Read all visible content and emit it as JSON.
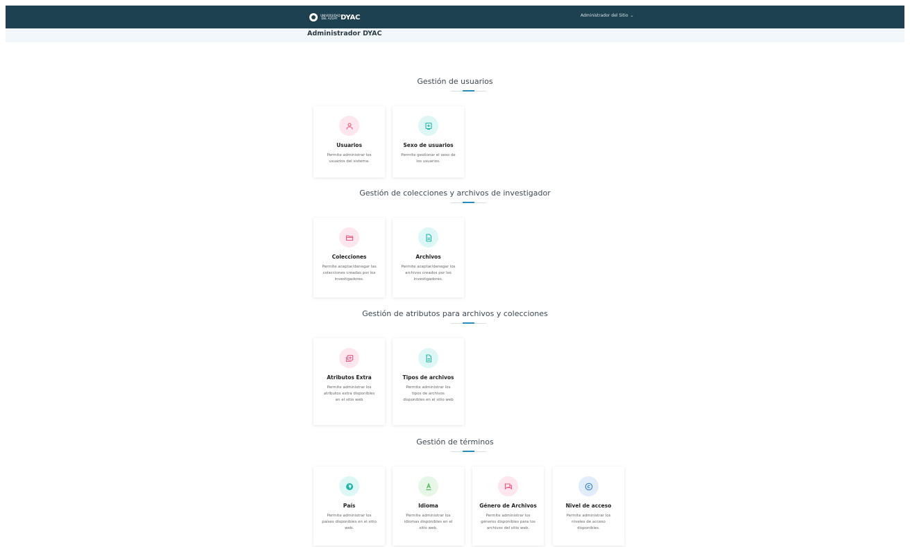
{
  "header": {
    "logo_univ": "UNIVERSIDAD DEL AZUAY",
    "logo_brand": "DYAC",
    "user_menu": "Administrador del Sitio",
    "subtitle": "Administrador DYAC"
  },
  "colors": {
    "topbar": "#1d4151",
    "accent": "#2a8bbd",
    "pink": "#e8577f",
    "teal": "#1fb5a8",
    "blue": "#2f7ed8",
    "green": "#43b24b"
  },
  "sections": [
    {
      "title": "Gestión de usuarios",
      "cards": [
        {
          "icon": "user-icon",
          "title": "Usuarios",
          "desc": "Permite administrar los usuarios del sistema."
        },
        {
          "icon": "id-badge-icon",
          "title": "Sexo de usuarios",
          "desc": "Permite gestionar el sexo de los usuarios."
        }
      ]
    },
    {
      "title": "Gestión de colecciones y archivos de investigador",
      "cards": [
        {
          "icon": "folder-icon",
          "title": "Colecciones",
          "desc": "Permite aceptar/denegar las colecciones creadas por los investigadores."
        },
        {
          "icon": "file-icon",
          "title": "Archivos",
          "desc": "Permite aceptar/denegar los archivos creados por los investigadores."
        }
      ]
    },
    {
      "title": "Gestión de atributos para archivos y colecciones",
      "cards": [
        {
          "icon": "add-box-icon",
          "title": "Atributos Extra",
          "desc": "Permite administrar los atributos extra disponibles en el sitio web"
        },
        {
          "icon": "document-icon",
          "title": "Tipos de archivos",
          "desc": "Permite administrar los tipos de archivos disponibles en el sitio web"
        }
      ]
    },
    {
      "title": "Gestión de términos",
      "cards": [
        {
          "icon": "globe-icon",
          "title": "País",
          "desc": "Permite administrar los países disponibles en el sitio web."
        },
        {
          "icon": "font-icon",
          "title": "Idioma",
          "desc": "Permite administrar los idiomas disponibles en el sitio web."
        },
        {
          "icon": "chat-icon",
          "title": "Género de Archivos",
          "desc": "Permite administrar los géneros disponibles para los archivos del sitio web."
        },
        {
          "icon": "copyright-icon",
          "title": "Nivel de acceso",
          "desc": "Permite administrar los niveles de acceso disponibles."
        }
      ]
    }
  ]
}
